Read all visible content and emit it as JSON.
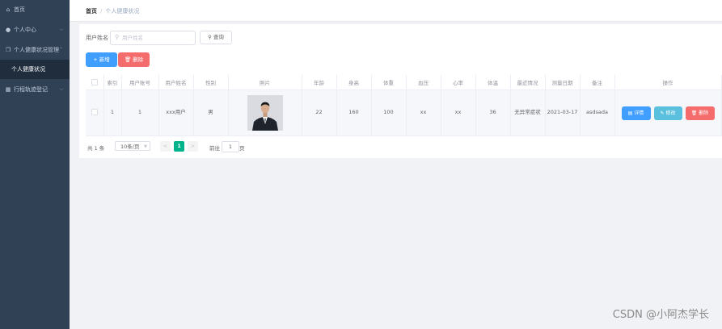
{
  "sidebar": {
    "items": [
      {
        "label": "首页",
        "icon": "home-icon",
        "glyph": "⌂"
      },
      {
        "label": "个人中心",
        "icon": "user-icon",
        "glyph": "👤",
        "chevron": "⌵"
      },
      {
        "label": "个人健康状况管理",
        "icon": "document-icon",
        "glyph": "❐",
        "chevron": "⌃"
      },
      {
        "label": "个人健康状况",
        "sub": true,
        "active": true
      },
      {
        "label": "行程轨迹登记",
        "icon": "grid-icon",
        "glyph": "▦",
        "chevron": "⌵"
      }
    ]
  },
  "breadcrumb": {
    "home": "首页",
    "separator": "/",
    "current": "个人健康状况"
  },
  "search": {
    "label": "用户姓名",
    "placeholder": "用户姓名",
    "icon": "search-icon",
    "button": "查询"
  },
  "toolbar": {
    "add": "新增",
    "delete": "删除"
  },
  "table": {
    "headers": [
      "",
      "索引",
      "用户账号",
      "用户姓名",
      "性别",
      "照片",
      "年龄",
      "身高",
      "体重",
      "血压",
      "心率",
      "体温",
      "最近情况",
      "测量日期",
      "备注",
      "操作"
    ],
    "rows": [
      {
        "index": "1",
        "account": "1",
        "name": "xxx用户",
        "gender": "男",
        "age": "22",
        "height": "160",
        "weight": "100",
        "blood_pressure": "xx",
        "heart_rate": "xx",
        "temperature": "36",
        "recent": "无异常症状",
        "date": "2021-03-17",
        "remark": "asdsada",
        "actions": {
          "view": "详情",
          "edit": "修改",
          "delete": "删除"
        }
      }
    ]
  },
  "pagination": {
    "total": "共 1 条",
    "page_size": "10条/页",
    "prev": "<",
    "current": "1",
    "next": ">",
    "goto": "前往",
    "goto_value": "1",
    "page_unit": "页"
  },
  "watermark": "CSDN @小阿杰学长",
  "colors": {
    "sidebar_bg": "#304156",
    "primary": "#409eff",
    "danger": "#f56c6c",
    "info": "#5bc0de",
    "page_active": "#00b38a"
  }
}
